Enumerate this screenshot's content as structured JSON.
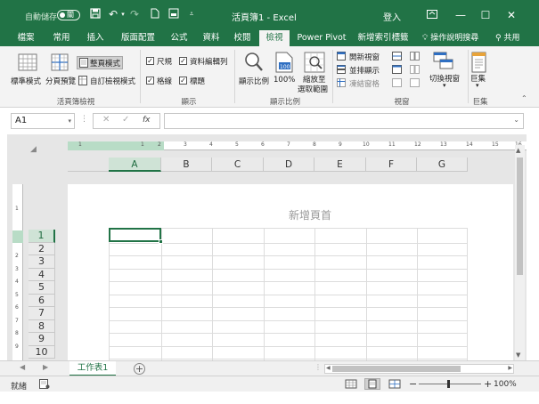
{
  "titlebar": {
    "autosave_label": "自動儲存",
    "autosave_state": "關",
    "doc_title": "活頁簿1  -  Excel",
    "signin": "登入",
    "colors": {
      "brand": "#217346"
    }
  },
  "tabs": [
    {
      "label": "檔案"
    },
    {
      "label": "常用"
    },
    {
      "label": "插入"
    },
    {
      "label": "版面配置"
    },
    {
      "label": "公式"
    },
    {
      "label": "資料"
    },
    {
      "label": "校閱"
    },
    {
      "label": "檢視",
      "active": true
    },
    {
      "label": "Power Pivot"
    },
    {
      "label": "新增索引標籤"
    }
  ],
  "tell_me": "操作說明搜尋",
  "share": "共用",
  "ribbon": {
    "workbook_views": {
      "normal": "標準模式",
      "page_break": "分頁預覽",
      "page_layout": "整頁模式",
      "custom_views": "自訂檢視模式",
      "group": "活頁簿檢視"
    },
    "show": {
      "ruler": "尺規",
      "formula_bar": "資料編輯列",
      "gridlines": "格線",
      "headings": "標題",
      "group": "顯示"
    },
    "zoom": {
      "zoom": "顯示比例",
      "hundred": "100%",
      "to_selection_1": "縮放至",
      "to_selection_2": "選取範圍",
      "group": "顯示比例"
    },
    "window": {
      "new_window": "開新視窗",
      "arrange_all": "並排顯示",
      "freeze_panes": "凍結窗格",
      "switch_windows": "切換視窗",
      "group": "視窗"
    },
    "macros": {
      "macros": "巨集",
      "group": "巨集"
    }
  },
  "formula_bar": {
    "name_box": "A1",
    "fx": "fx",
    "value": ""
  },
  "columns": [
    "A",
    "B",
    "C",
    "D",
    "E",
    "F",
    "G"
  ],
  "rows": [
    "1",
    "2",
    "3",
    "4",
    "5",
    "6",
    "7",
    "8",
    "9",
    "10"
  ],
  "header_placeholder": "新增頁首",
  "hruler_numbers": [
    "1",
    "1",
    "2",
    "3",
    "4",
    "5",
    "6",
    "7",
    "8",
    "9",
    "10",
    "11",
    "12",
    "13",
    "14",
    "15",
    "16",
    "17"
  ],
  "vruler_numbers": [
    "1",
    "2",
    "3",
    "4",
    "5",
    "6",
    "7",
    "8",
    "9"
  ],
  "sheet_tab": "工作表1",
  "status": {
    "ready": "就緒",
    "zoom": "100%"
  }
}
